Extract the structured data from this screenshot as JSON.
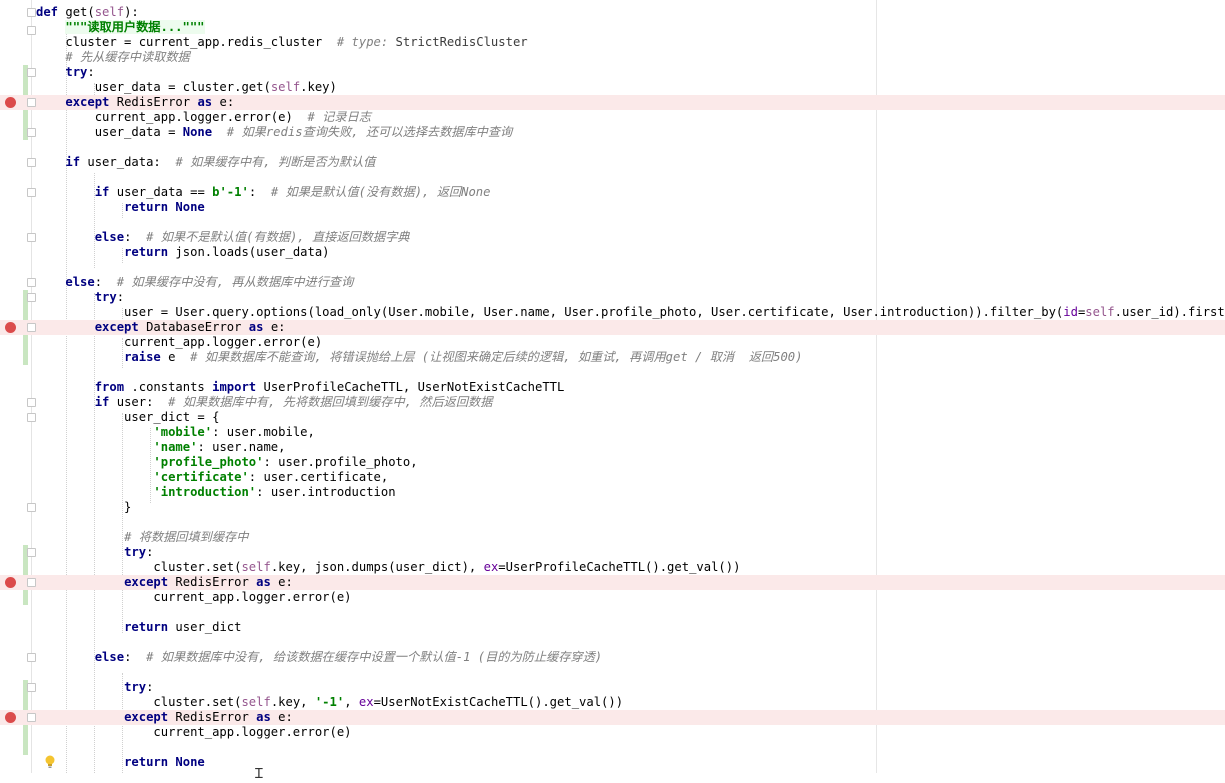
{
  "editor": {
    "language": "python",
    "lines": [
      {
        "bp": false,
        "segs": [
          [
            "k",
            "def"
          ],
          [
            "t",
            " get("
          ],
          [
            "s",
            "self"
          ],
          [
            "t",
            "):"
          ]
        ]
      },
      {
        "bp": false,
        "segs": [
          [
            "t",
            "    "
          ],
          [
            "d",
            "\"\"\"读取用户数据...\"\"\""
          ]
        ]
      },
      {
        "bp": false,
        "segs": [
          [
            "t",
            "    cluster = current_app.redis_cluster  "
          ],
          [
            "c",
            "# type: "
          ],
          [
            "y",
            "StrictRedisCluster"
          ]
        ]
      },
      {
        "bp": false,
        "segs": [
          [
            "t",
            "    "
          ],
          [
            "c",
            "# 先从缓存中读取数据"
          ]
        ]
      },
      {
        "bp": false,
        "segs": [
          [
            "t",
            "    "
          ],
          [
            "k",
            "try"
          ],
          [
            "t",
            ":"
          ]
        ]
      },
      {
        "bp": false,
        "segs": [
          [
            "t",
            "        user_data = cluster.get("
          ],
          [
            "s",
            "self"
          ],
          [
            "t",
            ".key)"
          ]
        ]
      },
      {
        "bp": true,
        "segs": [
          [
            "t",
            "    "
          ],
          [
            "k",
            "except"
          ],
          [
            "t",
            " RedisError "
          ],
          [
            "k",
            "as"
          ],
          [
            "t",
            " e:"
          ]
        ]
      },
      {
        "bp": false,
        "segs": [
          [
            "t",
            "        current_app.logger.error(e)  "
          ],
          [
            "c",
            "# 记录日志"
          ]
        ]
      },
      {
        "bp": false,
        "segs": [
          [
            "t",
            "        user_data = "
          ],
          [
            "k",
            "None"
          ],
          [
            "t",
            "  "
          ],
          [
            "c",
            "# 如果redis查询失败, 还可以选择去数据库中查询"
          ]
        ]
      },
      {
        "bp": false,
        "segs": []
      },
      {
        "bp": false,
        "segs": [
          [
            "t",
            "    "
          ],
          [
            "k",
            "if"
          ],
          [
            "t",
            " user_data:  "
          ],
          [
            "c",
            "# 如果缓存中有, 判断是否为默认值"
          ]
        ]
      },
      {
        "bp": false,
        "segs": []
      },
      {
        "bp": false,
        "segs": [
          [
            "t",
            "        "
          ],
          [
            "k",
            "if"
          ],
          [
            "t",
            " user_data == "
          ],
          [
            "g",
            "b'-1'"
          ],
          [
            "t",
            ":  "
          ],
          [
            "c",
            "# 如果是默认值(没有数据), 返回None"
          ]
        ]
      },
      {
        "bp": false,
        "segs": [
          [
            "t",
            "            "
          ],
          [
            "k",
            "return None"
          ]
        ]
      },
      {
        "bp": false,
        "segs": []
      },
      {
        "bp": false,
        "segs": [
          [
            "t",
            "        "
          ],
          [
            "k",
            "else"
          ],
          [
            "t",
            ":  "
          ],
          [
            "c",
            "# 如果不是默认值(有数据), 直接返回数据字典"
          ]
        ]
      },
      {
        "bp": false,
        "segs": [
          [
            "t",
            "            "
          ],
          [
            "k",
            "return"
          ],
          [
            "t",
            " json.loads(user_data)"
          ]
        ]
      },
      {
        "bp": false,
        "segs": []
      },
      {
        "bp": false,
        "segs": [
          [
            "t",
            "    "
          ],
          [
            "k",
            "else"
          ],
          [
            "t",
            ":  "
          ],
          [
            "c",
            "# 如果缓存中没有, 再从数据库中进行查询"
          ]
        ]
      },
      {
        "bp": false,
        "segs": [
          [
            "t",
            "        "
          ],
          [
            "k",
            "try"
          ],
          [
            "t",
            ":"
          ]
        ]
      },
      {
        "bp": false,
        "segs": [
          [
            "t",
            "            user = User.query.options(load_only(User.mobile, User.name, User.profile_photo, User.certificate, User.introduction)).filter_by("
          ],
          [
            "a",
            "id"
          ],
          [
            "t",
            "="
          ],
          [
            "s",
            "self"
          ],
          [
            "t",
            ".user_id).first()"
          ]
        ]
      },
      {
        "bp": true,
        "segs": [
          [
            "t",
            "        "
          ],
          [
            "k",
            "except"
          ],
          [
            "t",
            " DatabaseError "
          ],
          [
            "k",
            "as"
          ],
          [
            "t",
            " e:"
          ]
        ]
      },
      {
        "bp": false,
        "segs": [
          [
            "t",
            "            current_app.logger.error(e)"
          ]
        ]
      },
      {
        "bp": false,
        "segs": [
          [
            "t",
            "            "
          ],
          [
            "k",
            "raise"
          ],
          [
            "t",
            " e  "
          ],
          [
            "c",
            "# 如果数据库不能查询, 将错误抛给上层 (让视图来确定后续的逻辑, 如重试, 再调用get / 取消  返回500)"
          ]
        ]
      },
      {
        "bp": false,
        "segs": []
      },
      {
        "bp": false,
        "segs": [
          [
            "t",
            "        "
          ],
          [
            "k",
            "from"
          ],
          [
            "t",
            " .constants "
          ],
          [
            "k",
            "import"
          ],
          [
            "t",
            " UserProfileCacheTTL, UserNotExistCacheTTL"
          ]
        ]
      },
      {
        "bp": false,
        "segs": [
          [
            "t",
            "        "
          ],
          [
            "k",
            "if"
          ],
          [
            "t",
            " user:  "
          ],
          [
            "c",
            "# 如果数据库中有, 先将数据回填到缓存中, 然后返回数据"
          ]
        ]
      },
      {
        "bp": false,
        "segs": [
          [
            "t",
            "            user_dict = {"
          ]
        ]
      },
      {
        "bp": false,
        "segs": [
          [
            "t",
            "                "
          ],
          [
            "g",
            "'mobile'"
          ],
          [
            "t",
            ": user.mobile,"
          ]
        ]
      },
      {
        "bp": false,
        "segs": [
          [
            "t",
            "                "
          ],
          [
            "g",
            "'name'"
          ],
          [
            "t",
            ": user.name,"
          ]
        ]
      },
      {
        "bp": false,
        "segs": [
          [
            "t",
            "                "
          ],
          [
            "g",
            "'profile_photo'"
          ],
          [
            "t",
            ": user.profile_photo,"
          ]
        ]
      },
      {
        "bp": false,
        "segs": [
          [
            "t",
            "                "
          ],
          [
            "g",
            "'certificate'"
          ],
          [
            "t",
            ": user.certificate,"
          ]
        ]
      },
      {
        "bp": false,
        "segs": [
          [
            "t",
            "                "
          ],
          [
            "g",
            "'introduction'"
          ],
          [
            "t",
            ": user.introduction"
          ]
        ]
      },
      {
        "bp": false,
        "segs": [
          [
            "t",
            "            }"
          ]
        ]
      },
      {
        "bp": false,
        "segs": []
      },
      {
        "bp": false,
        "segs": [
          [
            "t",
            "            "
          ],
          [
            "c",
            "# 将数据回填到缓存中"
          ]
        ]
      },
      {
        "bp": false,
        "segs": [
          [
            "t",
            "            "
          ],
          [
            "k",
            "try"
          ],
          [
            "t",
            ":"
          ]
        ]
      },
      {
        "bp": false,
        "segs": [
          [
            "t",
            "                cluster.set("
          ],
          [
            "s",
            "self"
          ],
          [
            "t",
            ".key, json.dumps(user_dict), "
          ],
          [
            "a",
            "ex"
          ],
          [
            "t",
            "=UserProfileCacheTTL().get_val())"
          ]
        ]
      },
      {
        "bp": true,
        "segs": [
          [
            "t",
            "            "
          ],
          [
            "k",
            "except"
          ],
          [
            "t",
            " RedisError "
          ],
          [
            "k",
            "as"
          ],
          [
            "t",
            " e:"
          ]
        ]
      },
      {
        "bp": false,
        "segs": [
          [
            "t",
            "                current_app.logger.error(e)"
          ]
        ]
      },
      {
        "bp": false,
        "segs": []
      },
      {
        "bp": false,
        "segs": [
          [
            "t",
            "            "
          ],
          [
            "k",
            "return"
          ],
          [
            "t",
            " user_dict"
          ]
        ]
      },
      {
        "bp": false,
        "segs": []
      },
      {
        "bp": false,
        "segs": [
          [
            "t",
            "        "
          ],
          [
            "k",
            "else"
          ],
          [
            "t",
            ":  "
          ],
          [
            "c",
            "# 如果数据库中没有, 给该数据在缓存中设置一个默认值-1 (目的为防止缓存穿透)"
          ]
        ]
      },
      {
        "bp": false,
        "segs": []
      },
      {
        "bp": false,
        "segs": [
          [
            "t",
            "            "
          ],
          [
            "k",
            "try"
          ],
          [
            "t",
            ":"
          ]
        ]
      },
      {
        "bp": false,
        "segs": [
          [
            "t",
            "                cluster.set("
          ],
          [
            "s",
            "self"
          ],
          [
            "t",
            ".key, "
          ],
          [
            "g",
            "'-1'"
          ],
          [
            "t",
            ", "
          ],
          [
            "a",
            "ex"
          ],
          [
            "t",
            "=UserNotExistCacheTTL().get_val())"
          ]
        ]
      },
      {
        "bp": true,
        "segs": [
          [
            "t",
            "            "
          ],
          [
            "k",
            "except"
          ],
          [
            "t",
            " RedisError "
          ],
          [
            "k",
            "as"
          ],
          [
            "t",
            " e:"
          ]
        ]
      },
      {
        "bp": false,
        "segs": [
          [
            "t",
            "                current_app.logger.error(e)"
          ]
        ]
      },
      {
        "bp": false,
        "segs": []
      },
      {
        "bp": false,
        "segs": [
          [
            "t",
            "            "
          ],
          [
            "k",
            "return None"
          ]
        ]
      }
    ]
  }
}
